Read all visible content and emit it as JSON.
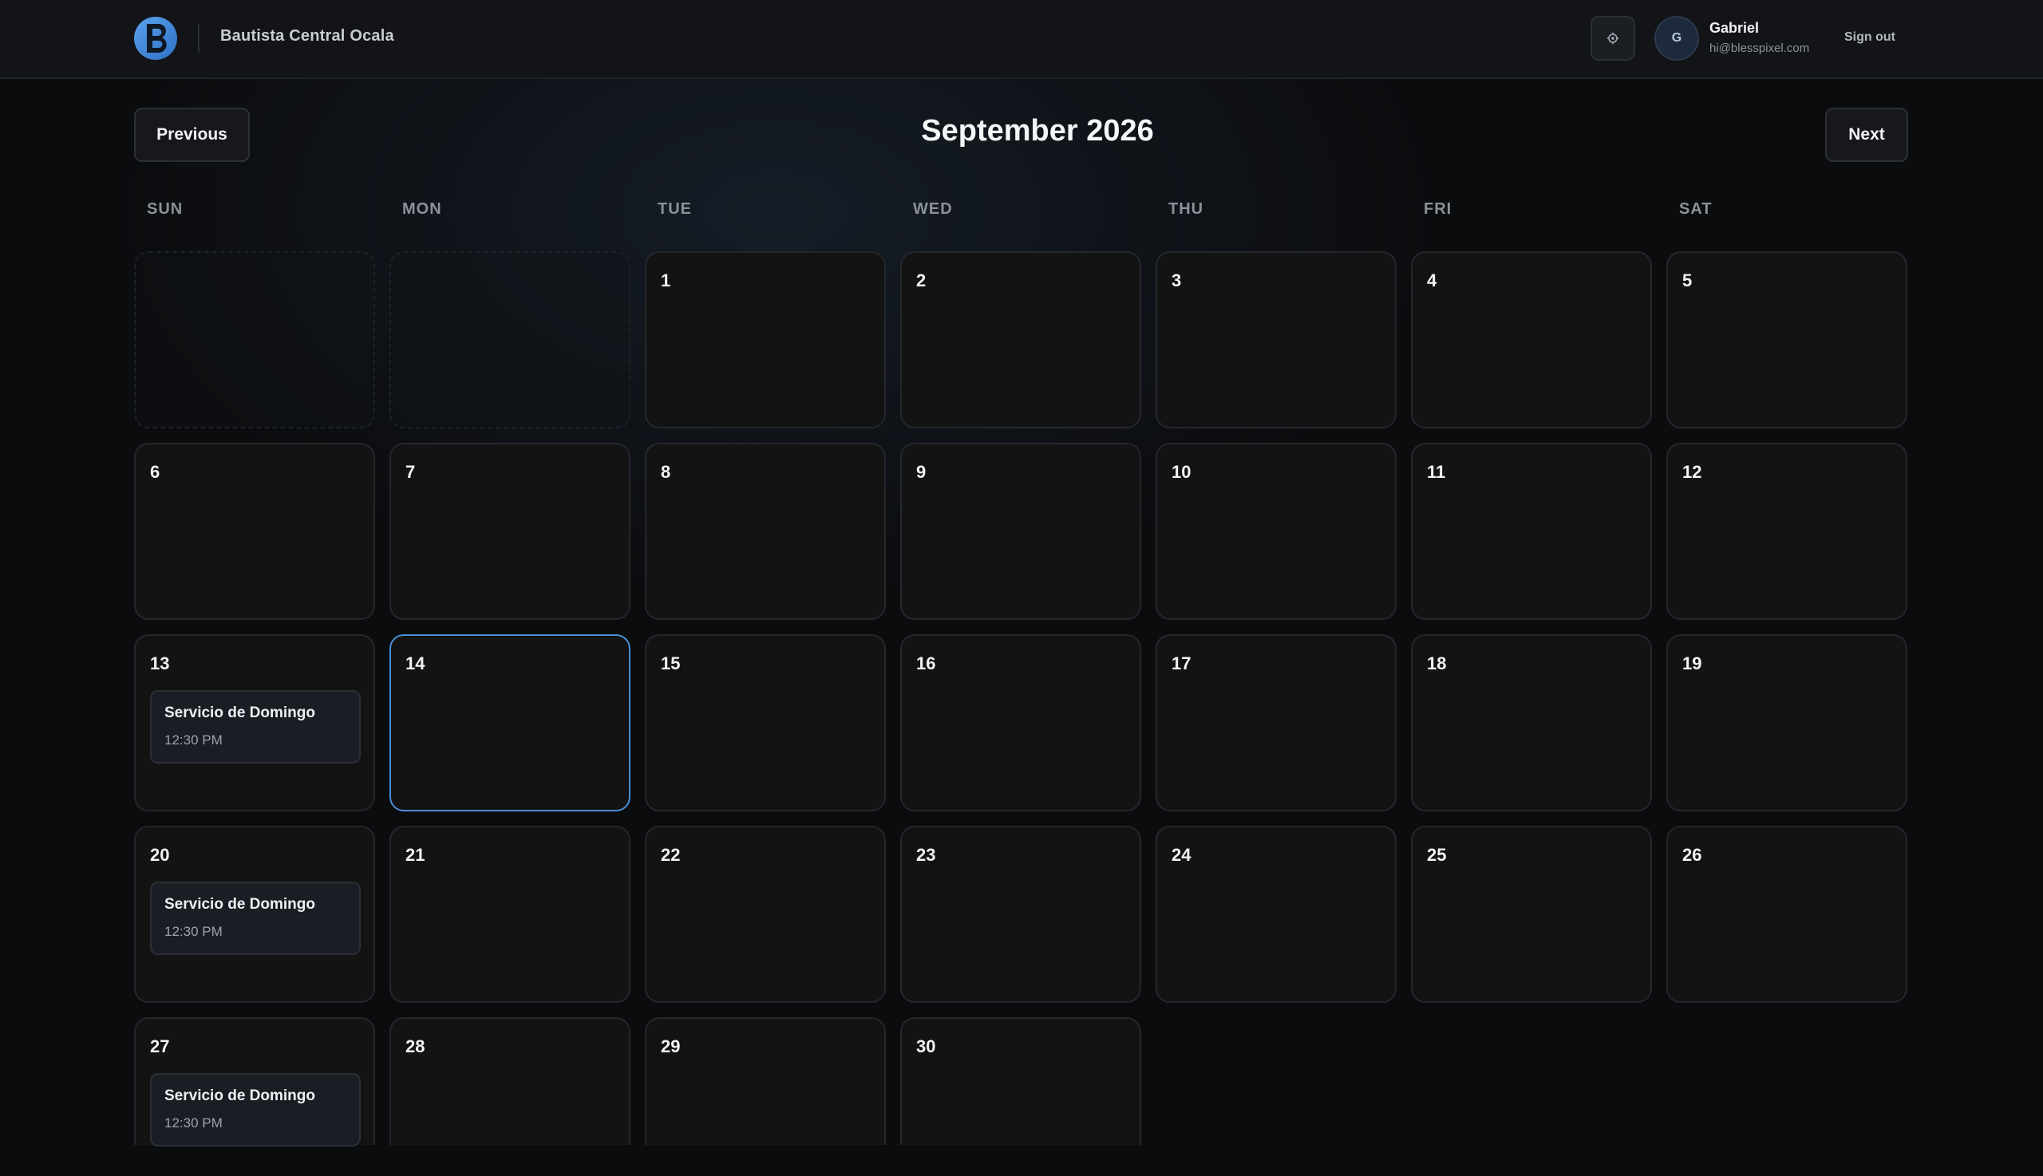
{
  "header": {
    "org_name": "Bautista Central Ocala",
    "settings_icon": "gear-icon",
    "user": {
      "initial": "G",
      "name": "Gabriel",
      "email": "hi@blesspixel.com"
    },
    "signout_label": "Sign out"
  },
  "calendar": {
    "prev_label": "Previous",
    "next_label": "Next",
    "month_title": "September 2026",
    "weekdays": [
      "SUN",
      "MON",
      "TUE",
      "WED",
      "THU",
      "FRI",
      "SAT"
    ],
    "today": 14,
    "days": [
      {
        "day": "1"
      },
      {
        "day": "2"
      },
      {
        "day": "3"
      },
      {
        "day": "4"
      },
      {
        "day": "5"
      },
      {
        "day": "6"
      },
      {
        "day": "7"
      },
      {
        "day": "8"
      },
      {
        "day": "9"
      },
      {
        "day": "10"
      },
      {
        "day": "11"
      },
      {
        "day": "12"
      },
      {
        "day": "13",
        "event": {
          "title": "Servicio de Domingo",
          "time": "12:30 PM"
        }
      },
      {
        "day": "14"
      },
      {
        "day": "15"
      },
      {
        "day": "16"
      },
      {
        "day": "17"
      },
      {
        "day": "18"
      },
      {
        "day": "19"
      },
      {
        "day": "20",
        "event": {
          "title": "Servicio de Domingo",
          "time": "12:30 PM"
        }
      },
      {
        "day": "21"
      },
      {
        "day": "22"
      },
      {
        "day": "23"
      },
      {
        "day": "24"
      },
      {
        "day": "25"
      },
      {
        "day": "26"
      },
      {
        "day": "27",
        "event": {
          "title": "Servicio de Domingo",
          "time": "12:30 PM"
        }
      },
      {
        "day": "28"
      },
      {
        "day": "29"
      },
      {
        "day": "30"
      }
    ]
  },
  "colors": {
    "accent": "#4a8fd6",
    "background": "#0b0c0e",
    "cell": "#131313"
  }
}
